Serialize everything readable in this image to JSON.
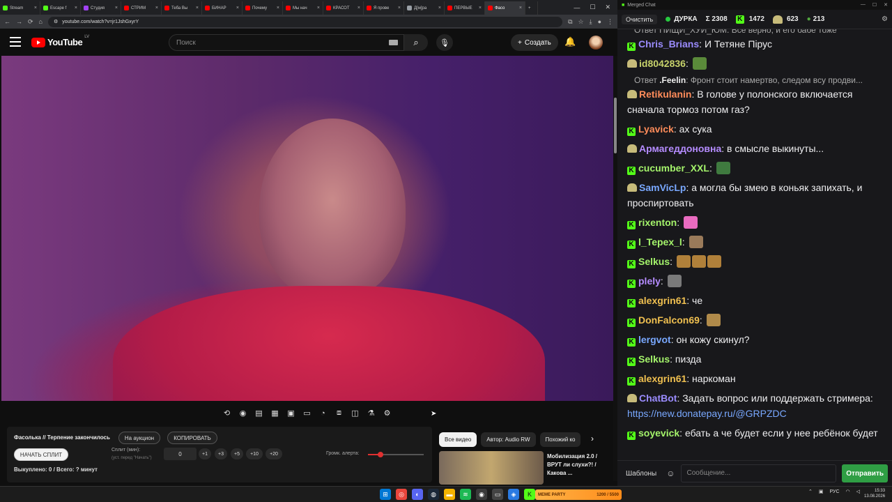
{
  "browser": {
    "tabs": [
      {
        "title": "Stream",
        "color": "#53fc18"
      },
      {
        "title": "Escape f",
        "color": "#53fc18"
      },
      {
        "title": "Студия",
        "color": "#a142f4"
      },
      {
        "title": "СТРИМ",
        "color": "#ff0000"
      },
      {
        "title": "Теба Вы",
        "color": "#ff0000"
      },
      {
        "title": "БИНАР",
        "color": "#ff0000"
      },
      {
        "title": "Почему",
        "color": "#ff0000"
      },
      {
        "title": "Мы нач",
        "color": "#ff0000"
      },
      {
        "title": "КРАСОТ",
        "color": "#ff0000"
      },
      {
        "title": "Я прове",
        "color": "#ff0000"
      },
      {
        "title": "Д[м]ра",
        "color": "#9aa0a6"
      },
      {
        "title": "ПЕРВЫЕ",
        "color": "#ff0000"
      },
      {
        "title": "Фасо",
        "color": "#ff0000",
        "active": true
      }
    ],
    "url": "youtube.com/watch?v=jr1JshGxyrY"
  },
  "youtube": {
    "region": "LV",
    "logo_text": "YouTube",
    "search_placeholder": "Поиск",
    "create_label": "Создать"
  },
  "panel": {
    "title": "Фасолька // Терпение закончилось",
    "auction_btn": "На аукцион",
    "copy_btn": "КОПИРОВАТЬ",
    "start_split_btn": "НАЧАТЬ СПЛИТ",
    "split_label": "Сплит (мин):",
    "split_hint": "(уст. перед \"Начать\")",
    "split_value": "0",
    "increments": [
      "+1",
      "+3",
      "+5",
      "+10",
      "+20"
    ],
    "volume_label": "Громк. алерта:",
    "volume_level": 0.22,
    "sold_text": "Выкуплено: 0 / Всего: ? минут"
  },
  "reco": {
    "chips": [
      {
        "label": "Все видео",
        "active": true
      },
      {
        "label": "Автор: Audio RW",
        "active": false
      },
      {
        "label": "Похожий ко",
        "active": false
      }
    ],
    "video_title": "Мобилизация 2.0 / ВРУТ ли слухи?! / Какова ..."
  },
  "chat": {
    "window_title": "Merged Chat",
    "clear_label": "Очистить",
    "channel": "ДУРКА",
    "total": "Σ 2308",
    "kick_count": "1472",
    "twitch_count": "623",
    "other_count": "213",
    "top_reply": "Ответ ПИЩИ_ХУИ_ЮМ: Все верно, и его бабе тоже",
    "messages": [
      {
        "platform": "kick",
        "user": "Chris_Brians",
        "color": "#9b8cff",
        "text": "И Тетяне Пірус"
      },
      {
        "platform": "twitch",
        "user": "id8042836",
        "color": "#c7d26b",
        "text": "",
        "emote": "#5a8a3a"
      },
      {
        "reply": true,
        "reply_user": ".Feelin",
        "reply_text": "Фронт стоит намертво, следом всу продви..."
      },
      {
        "platform": "twitch",
        "user": "Retikulanin",
        "color": "#ff8c5a",
        "text": "В голове у полонского включается сначала тормоз потом газ?"
      },
      {
        "platform": "kick",
        "user": "Lyavick",
        "color": "#ff8c5a",
        "text": "ах сука"
      },
      {
        "platform": "twitch",
        "user": "Армагеддоновна",
        "color": "#b58cff",
        "text": "в смысле выкинуты..."
      },
      {
        "platform": "kick",
        "user": "cucumber_XXL",
        "color": "#a4f36b",
        "text": "",
        "emote": "#3f7a3f"
      },
      {
        "platform": "twitch",
        "user": "SamVicLp",
        "color": "#79a8ff",
        "text": "а могла бы змею в коньяк запихать, и проспиртовать"
      },
      {
        "platform": "kick",
        "user": "rixenton",
        "color": "#a4f36b",
        "text": "",
        "emote": "#e96bc0"
      },
      {
        "platform": "kick",
        "user": "l_Tepex_l",
        "color": "#a4f36b",
        "text": "",
        "emote": "#9a7a5a"
      },
      {
        "platform": "kick",
        "user": "Selkus",
        "color": "#a4f36b",
        "text": "",
        "emote": "#b0803a",
        "emote_count": 3
      },
      {
        "platform": "kick",
        "user": "plely",
        "color": "#b58cff",
        "text": "",
        "emote": "#7a7a7a"
      },
      {
        "platform": "kick",
        "user": "alexgrin61",
        "color": "#f0c050",
        "text": "че"
      },
      {
        "platform": "kick",
        "user": "DonFalcon69",
        "color": "#f0c050",
        "text": "",
        "emote": "#b08a4a"
      },
      {
        "platform": "kick",
        "user": "lergvot",
        "color": "#79a8ff",
        "text": "он кожу скинул?"
      },
      {
        "platform": "kick",
        "user": "Selkus",
        "color": "#a4f36b",
        "text": "пизда"
      },
      {
        "platform": "kick",
        "user": "alexgrin61",
        "color": "#f0c050",
        "text": "наркоман"
      },
      {
        "platform": "twitch",
        "user": "ChatBot",
        "color": "#9b8cff",
        "text": "Задать вопрос или поддержать стримера: ",
        "link": "https://new.donatepay.ru/@GRPZDC"
      },
      {
        "platform": "kick",
        "user": "soyevick",
        "color": "#a4f36b",
        "text": "ебать а че будет если у нее ребёнок будет"
      }
    ],
    "templates_label": "Шаблоны",
    "input_placeholder": "Сообщение...",
    "send_label": "Отправить"
  },
  "taskbar": {
    "widget_left": "MEME PARTY",
    "widget_progress": "1200 / 5500",
    "lang": "РУС",
    "time": "15:33",
    "date": "13.08.2026"
  }
}
